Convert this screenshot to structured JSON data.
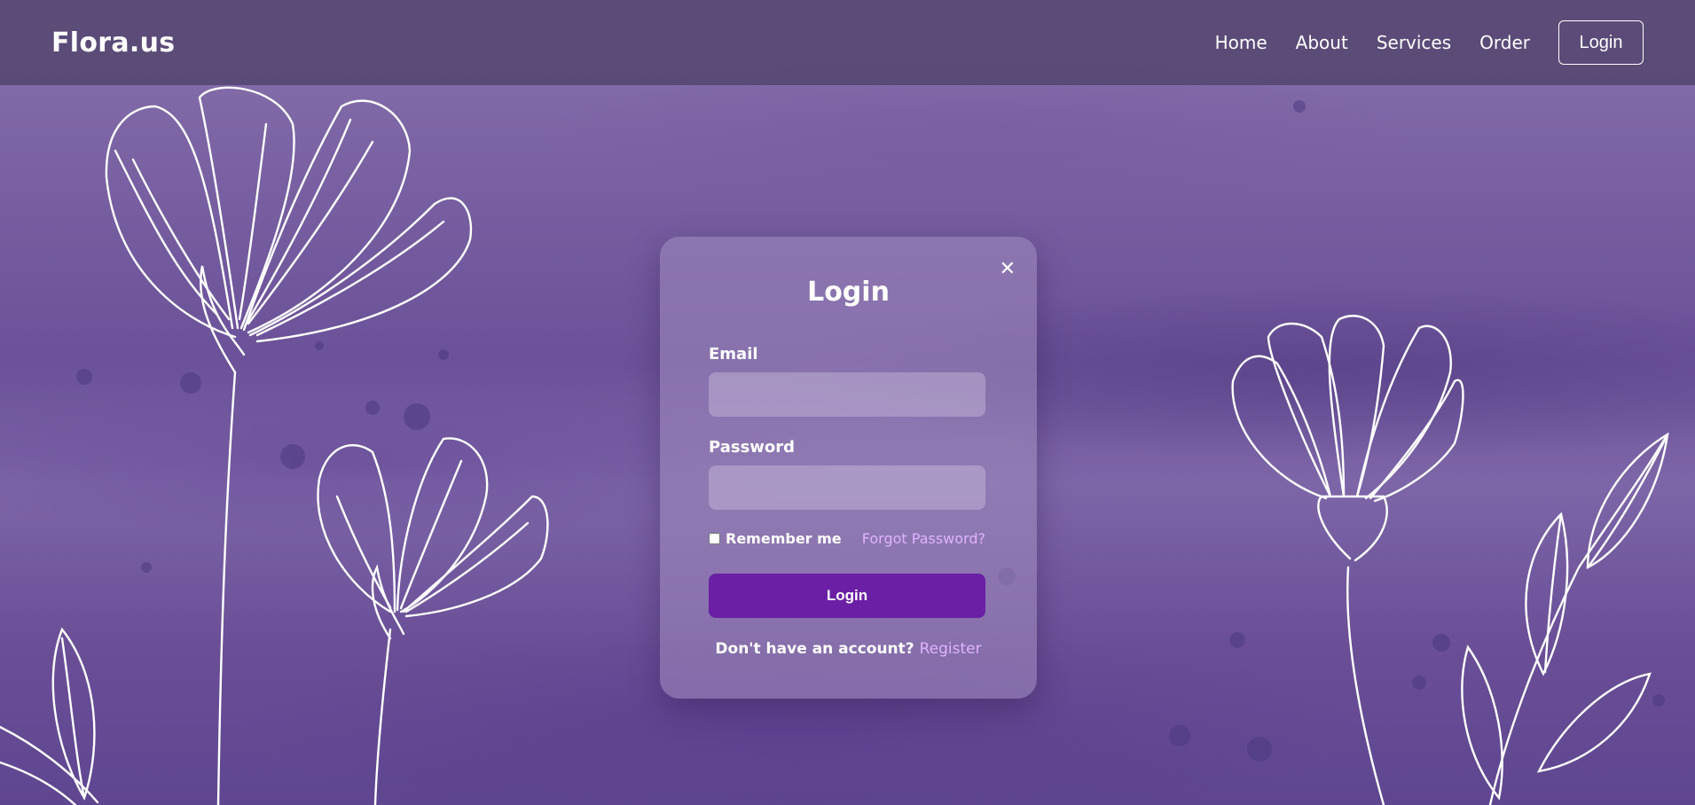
{
  "header": {
    "logo": "Flora.us",
    "nav": [
      "Home",
      "About",
      "Services",
      "Order"
    ],
    "login_button": "Login"
  },
  "modal": {
    "title": "Login",
    "close_icon": "close-icon",
    "email_label": "Email",
    "email_value": "",
    "password_label": "Password",
    "password_value": "",
    "remember_label": "Remember me",
    "remember_checked": false,
    "forgot_link": "Forgot Password?",
    "submit_label": "Login",
    "register_prompt": "Don't have an account?",
    "register_link": "Register"
  },
  "colors": {
    "primary_button": "#6a1fa5",
    "link": "#e0b3ff",
    "background": "#6a5391"
  }
}
